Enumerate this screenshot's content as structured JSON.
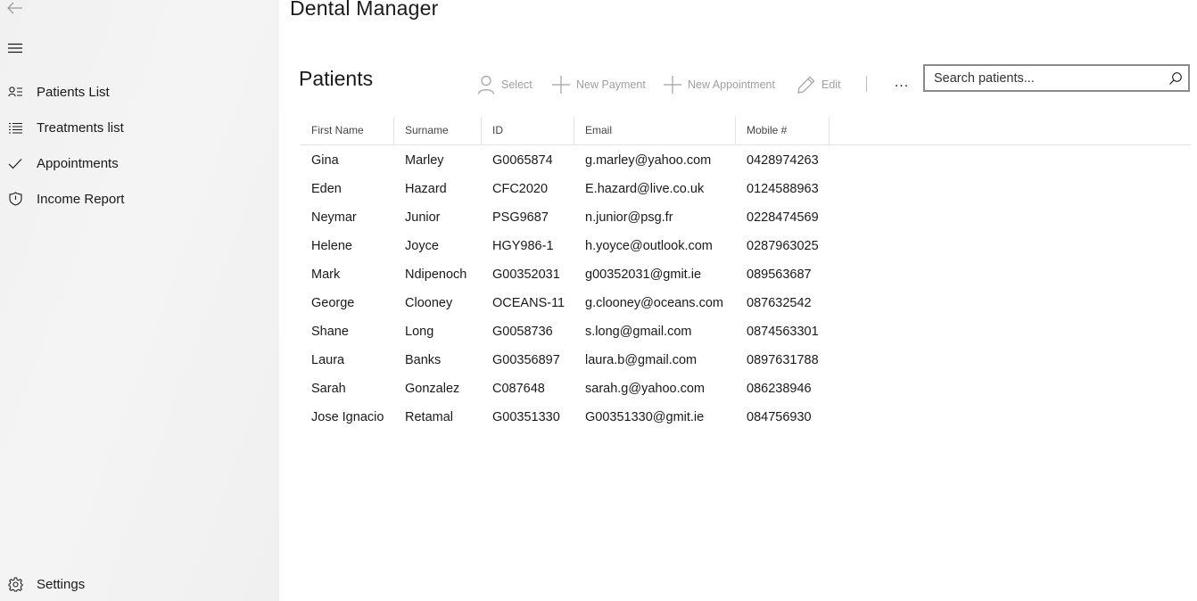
{
  "app_title": "Dental Manager",
  "sidebar": {
    "back_icon": "back-arrow-icon",
    "menu_icon": "hamburger-icon",
    "items": [
      {
        "label": "Patients List",
        "icon": "contact-list-icon"
      },
      {
        "label": "Treatments list",
        "icon": "bulleted-list-icon"
      },
      {
        "label": "Appointments",
        "icon": "checkmark-icon"
      },
      {
        "label": "Income Report",
        "icon": "shield-icon"
      }
    ],
    "settings": {
      "label": "Settings",
      "icon": "gear-icon"
    }
  },
  "page": {
    "title": "Patients"
  },
  "commands": {
    "select": "Select",
    "new_payment": "New Payment",
    "new_appointment": "New Appointment",
    "edit": "Edit",
    "more": "..."
  },
  "search": {
    "placeholder": "Search patients..."
  },
  "table": {
    "columns": [
      "First Name",
      "Surname",
      "ID",
      "Email",
      "Mobile #"
    ],
    "rows": [
      [
        "Gina",
        "Marley",
        "G0065874",
        "g.marley@yahoo.com",
        "0428974263"
      ],
      [
        "Eden",
        "Hazard",
        "CFC2020",
        "E.hazard@live.co.uk",
        "0124588963"
      ],
      [
        "Neymar",
        "Junior",
        "PSG9687",
        "n.junior@psg.fr",
        "0228474569"
      ],
      [
        "Helene",
        "Joyce",
        "HGY986-1",
        "h.yoyce@outlook.com",
        "0287963025"
      ],
      [
        "Mark",
        "Ndipenoch",
        "G00352031",
        "g00352031@gmit.ie",
        "089563687"
      ],
      [
        "George",
        "Clooney",
        "OCEANS-11",
        "g.clooney@oceans.com",
        "087632542"
      ],
      [
        "Shane",
        "Long",
        "G0058736",
        "s.long@gmail.com",
        "0874563301"
      ],
      [
        "Laura",
        "Banks",
        "G00356897",
        "laura.b@gmail.com",
        "0897631788"
      ],
      [
        "Sarah",
        "Gonzalez",
        "C087648",
        "sarah.g@yahoo.com",
        "086238946"
      ],
      [
        "Jose Ignacio",
        "Retamal",
        "G00351330",
        "G00351330@gmit.ie",
        "084756930"
      ]
    ]
  },
  "colors": {
    "sidebar_bg": "#f2f2f2",
    "command_disabled": "#a0a0a0",
    "text": "#1a1a1a",
    "search_border": "#8a8a8a"
  }
}
